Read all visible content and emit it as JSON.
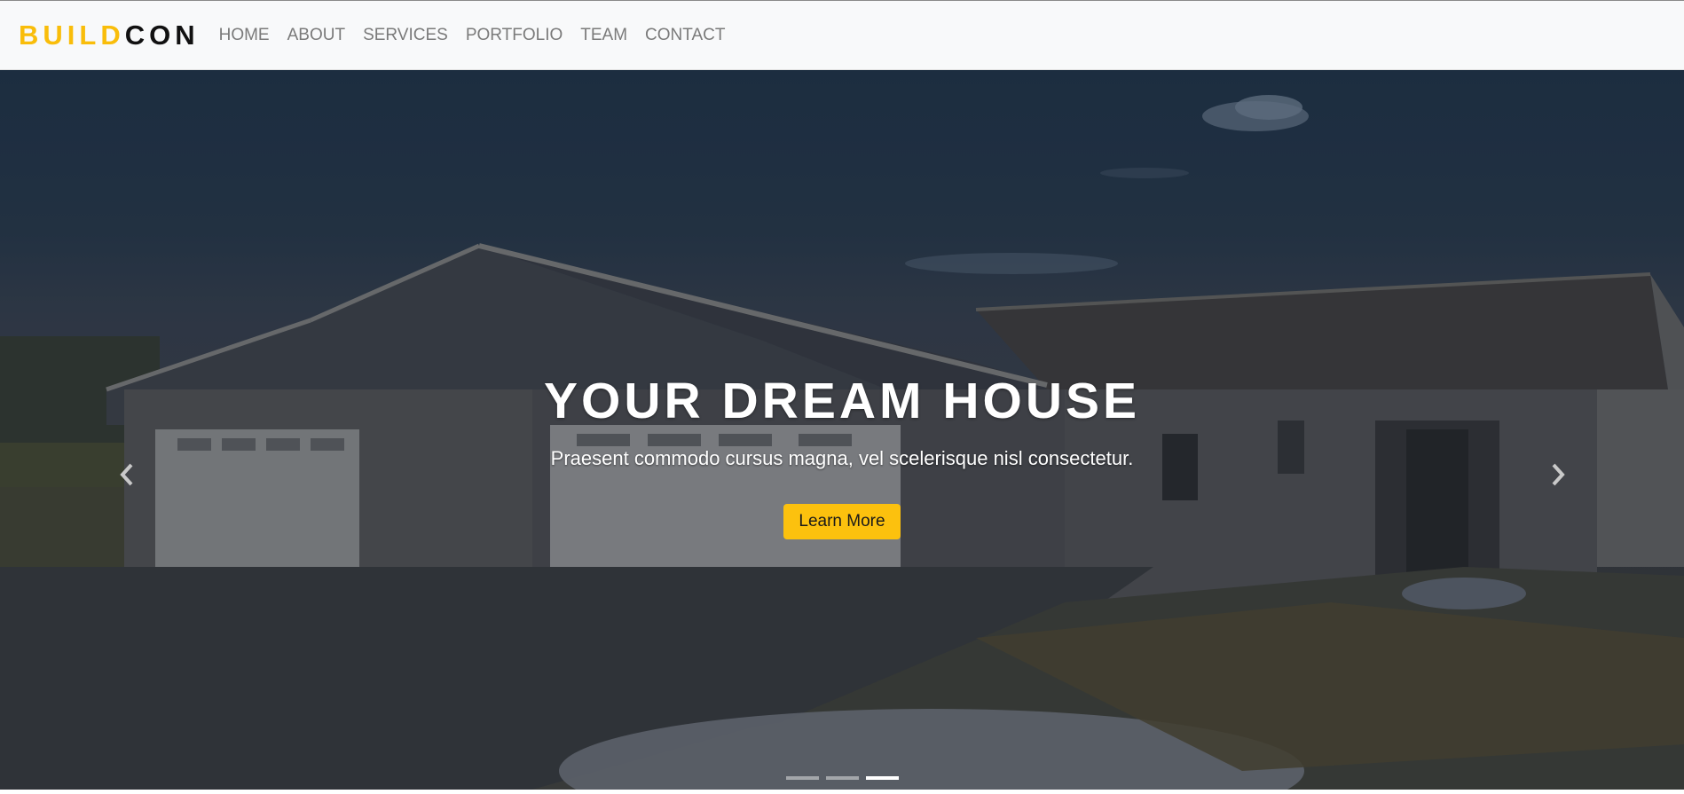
{
  "brand": {
    "part1": "BUILD",
    "part2": "CON"
  },
  "nav": {
    "items": [
      {
        "label": "HOME"
      },
      {
        "label": "ABOUT"
      },
      {
        "label": "SERVICES"
      },
      {
        "label": "PORTFOLIO"
      },
      {
        "label": "TEAM"
      },
      {
        "label": "CONTACT"
      }
    ]
  },
  "hero": {
    "title": "YOUR DREAM HOUSE",
    "subtitle": "Praesent commodo cursus magna, vel scelerisque nisl consectetur.",
    "cta_label": "Learn More",
    "prev_icon": "chevron-left-icon",
    "next_icon": "chevron-right-icon",
    "slide_count": 3,
    "active_slide": 3
  },
  "colors": {
    "accent": "#fcc10e",
    "brand_yellow": "#f9bd0a",
    "brand_dark": "#111111",
    "nav_text": "#7a7a7a",
    "navbar_bg": "#f8f9fa"
  }
}
